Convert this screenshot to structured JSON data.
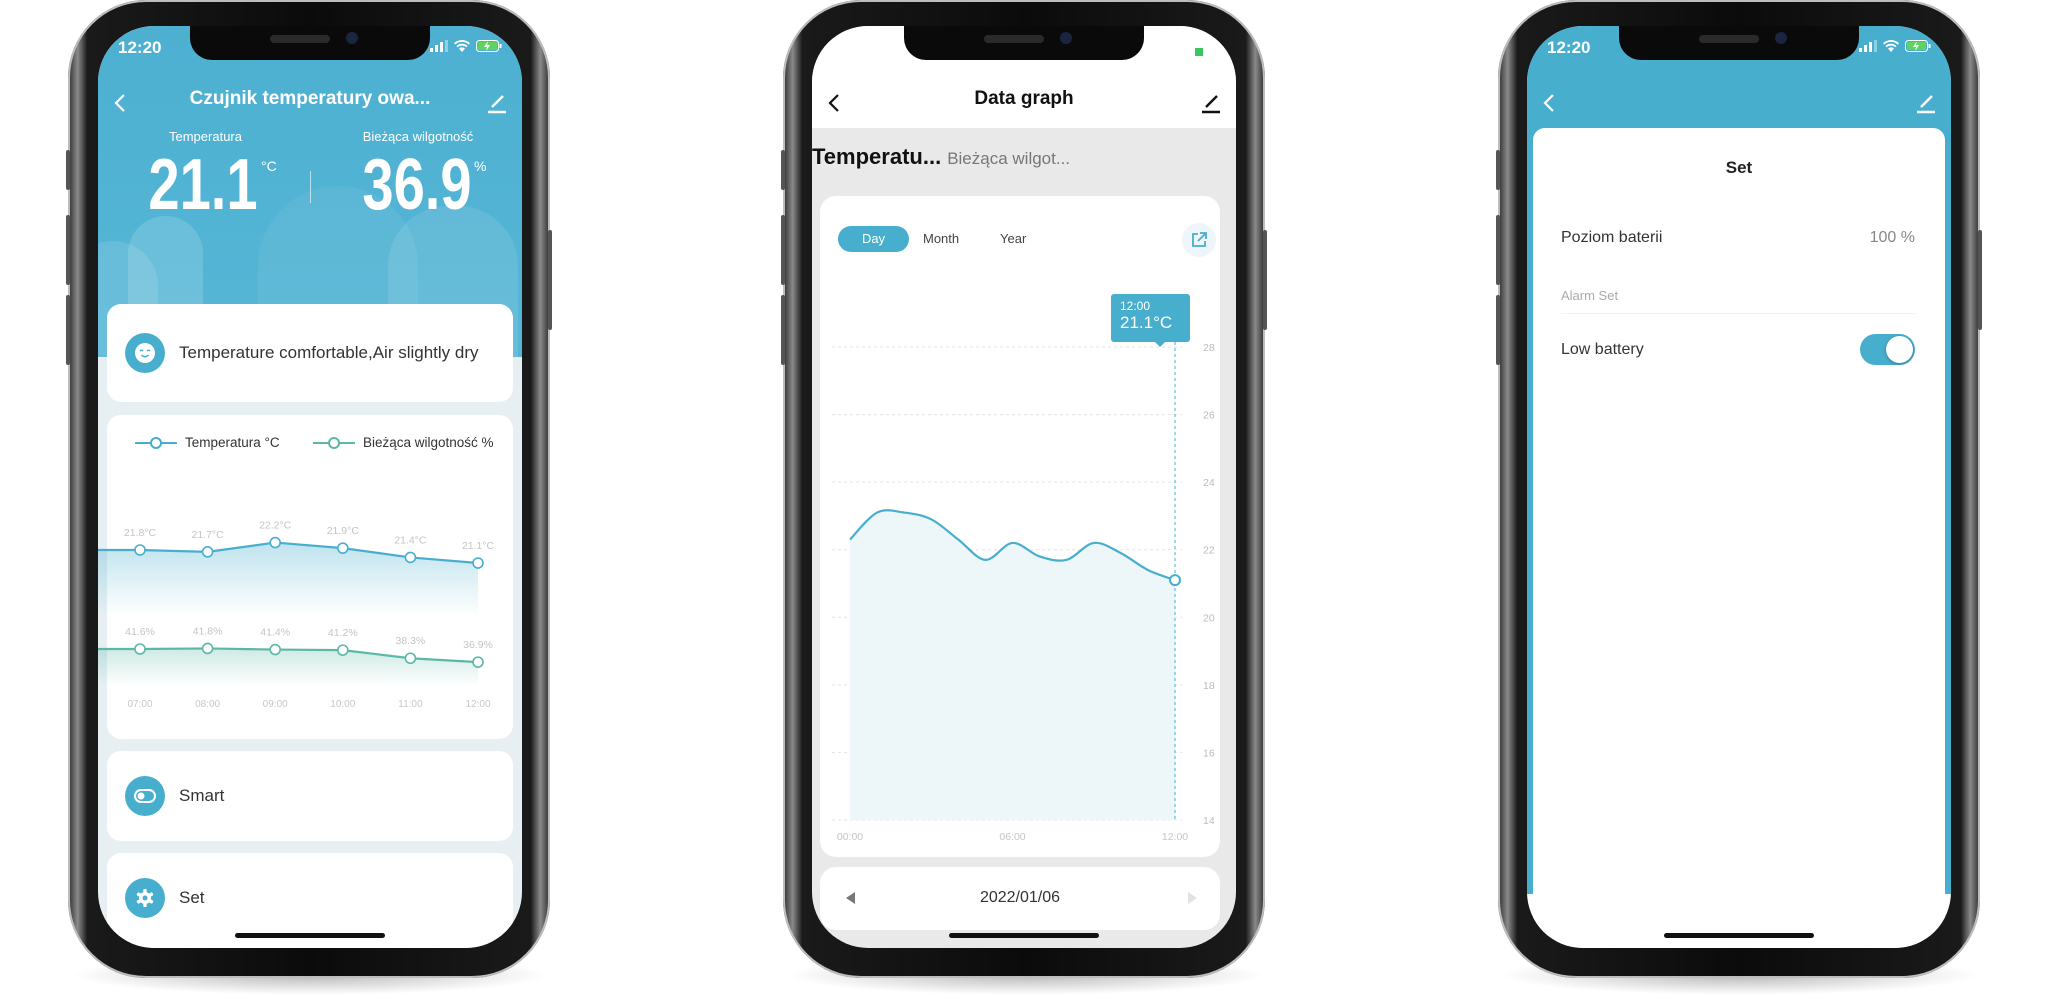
{
  "status_bar": {
    "time": "12:20"
  },
  "device_screen": {
    "title": "Czujnik temperatury owa...",
    "temperature_label": "Temperatura",
    "temperature_value": "21.1",
    "temperature_unit": "°C",
    "humidity_label": "Bieżąca wilgotność",
    "humidity_value": "36.9",
    "humidity_unit": "%",
    "comfort_message": "Temperature comfortable,Air slightly dry",
    "legend": [
      "Temperatura °C",
      "Bieżąca wilgotność %"
    ],
    "menu": [
      {
        "label": "Smart",
        "icon": "toggle-icon"
      },
      {
        "label": "Set",
        "icon": "gear-icon"
      }
    ]
  },
  "graph_screen": {
    "title": "Data graph",
    "metric_tabs": [
      "Temperatu...",
      "Bieżąca wilgot..."
    ],
    "period_tabs": [
      "Day",
      "Month",
      "Year"
    ],
    "active_period": "Day",
    "tooltip": {
      "time": "12:00",
      "value": "21.1°C"
    },
    "date": "2022/01/06"
  },
  "settings_screen": {
    "title": "Set",
    "battery_label": "Poziom baterii",
    "battery_value": "100 %",
    "alarm_section": "Alarm Set",
    "low_battery_label": "Low battery",
    "low_battery_enabled": true
  },
  "colors": {
    "accent": "#47aecd",
    "humidity": "#5cb8a6",
    "header_blue": "#4bafd0"
  },
  "chart_data": [
    {
      "type": "line",
      "categories": [
        "07:00",
        "08:00",
        "09:00",
        "10:00",
        "11:00",
        "12:00"
      ],
      "series": [
        {
          "name": "Temperatura °C",
          "values": [
            21.8,
            21.7,
            22.2,
            21.9,
            21.4,
            21.1
          ],
          "labels": [
            "21.8°C",
            "21.7°C",
            "22.2°C",
            "21.9°C",
            "21.4°C",
            "21.1°C"
          ]
        },
        {
          "name": "Bieżąca wilgotność %",
          "values": [
            41.6,
            41.8,
            41.4,
            41.2,
            38.3,
            36.9
          ],
          "labels": [
            "41.6%",
            "41.8%",
            "41.4%",
            "41.2%",
            "38.3%",
            "36.9%"
          ]
        }
      ],
      "legend": "top"
    },
    {
      "type": "area",
      "x": [
        "00:00",
        "01:00",
        "02:00",
        "03:00",
        "04:00",
        "05:00",
        "06:00",
        "07:00",
        "08:00",
        "09:00",
        "10:00",
        "11:00",
        "12:00"
      ],
      "values": [
        22.3,
        23.1,
        23.1,
        22.9,
        22.3,
        21.7,
        22.2,
        21.8,
        21.7,
        22.2,
        21.9,
        21.4,
        21.1
      ],
      "x_ticks": [
        "00:00",
        "06:00",
        "12:00"
      ],
      "y_ticks": [
        "28",
        "26",
        "24",
        "22",
        "20",
        "18",
        "16",
        "14"
      ],
      "ylim": [
        14,
        28
      ],
      "y_axis_position": "right",
      "grid": true
    }
  ]
}
